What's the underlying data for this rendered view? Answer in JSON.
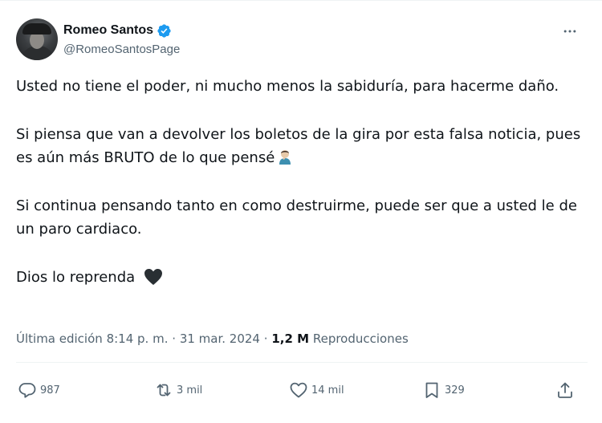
{
  "author": {
    "display_name": "Romeo Santos",
    "handle": "@RomeoSantosPage",
    "verified_icon": "verified-badge-icon",
    "verified_color": "#1d9bf0"
  },
  "more_icon": "more-horizontal-icon",
  "tweet": {
    "paragraphs": [
      "Usted no tiene el poder, ni mucho menos la sabiduría, para hacerme daño.",
      "Si piensa que van a devolver los boletos de la gira por esta falsa noticia, pues es aún más BRUTO de lo que pensé",
      "Si continua pensando tanto en como destruirme, puede ser que a usted le de un paro cardiaco.",
      "Dios lo reprenda"
    ],
    "emoji_p2": "facepalm-person-emoji",
    "emoji_p4": "black-heart-emoji"
  },
  "meta": {
    "edited_label": "Última edición",
    "time": "8:14 p. m.",
    "separator": "·",
    "date": "31 mar. 2024",
    "views_count": "1,2 M",
    "views_label": "Reproducciones"
  },
  "actions": {
    "reply_count": "987",
    "retweet_count": "3 mil",
    "like_count": "14 mil",
    "bookmark_count": "329",
    "reply_icon": "reply-icon",
    "retweet_icon": "retweet-icon",
    "like_icon": "heart-icon",
    "bookmark_icon": "bookmark-icon",
    "share_icon": "share-icon"
  },
  "colors": {
    "text_primary": "#0f1419",
    "text_secondary": "#536471",
    "divider": "#eff3f4"
  }
}
